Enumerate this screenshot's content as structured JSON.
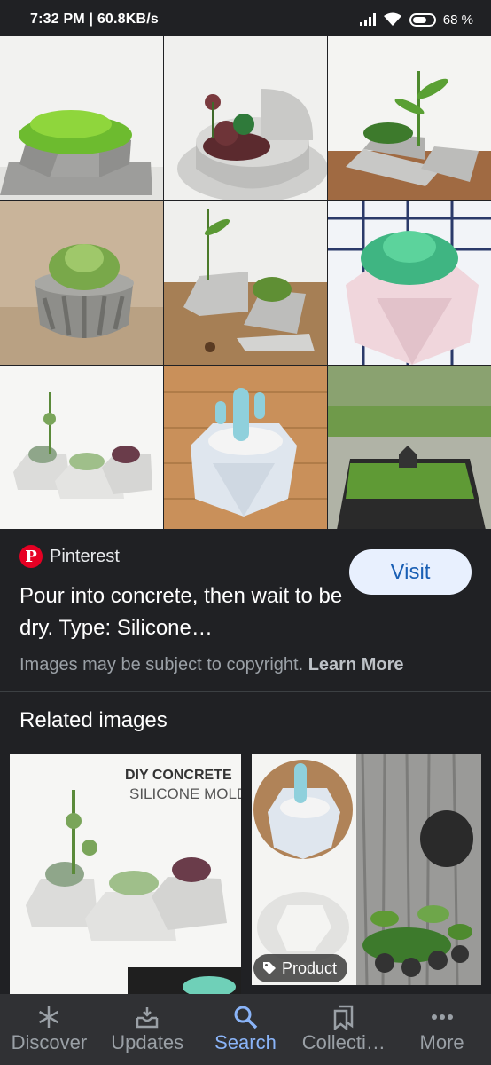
{
  "status_bar": {
    "time_speed": "7:32 PM | 60.8KB/s",
    "battery": "68",
    "battery_fraction": 0.68
  },
  "image_grid": {
    "tiles": [
      "concrete-planter-green-moss",
      "round-planter-succulents",
      "tray-planters-bamboo",
      "ribbed-pot-succulent",
      "triangle-planters-bamboo",
      "pink-geometric-pot",
      "hexagon-planters-succulents",
      "blue-geometric-pot-cactus",
      "black-square-planter-moss"
    ]
  },
  "result": {
    "source_icon": "pinterest-icon",
    "source_name": "Pinterest",
    "visit_label": "Visit",
    "title": "Pour into concrete, then wait to be dry. Type: Silicone…",
    "copyright_text": "Images may be subject to copyright.",
    "learn_more": "Learn More"
  },
  "related": {
    "heading": "Related images",
    "card1_text_line1": "DIY CONCRETE",
    "card1_text_line2": "SILICONE MOLD",
    "product_label": "Product"
  },
  "nav": {
    "items": [
      {
        "label": "Discover",
        "icon": "asterisk-icon"
      },
      {
        "label": "Updates",
        "icon": "inbox-icon"
      },
      {
        "label": "Search",
        "icon": "search-icon"
      },
      {
        "label": "Collecti…",
        "icon": "bookmarks-icon"
      },
      {
        "label": "More",
        "icon": "more-dots-icon"
      }
    ]
  },
  "colors": {
    "background": "#202124",
    "accent": "#8ab4f8",
    "pinterest": "#e60023",
    "visit_bg": "#e8f0fe",
    "visit_text": "#1a5fb4"
  }
}
